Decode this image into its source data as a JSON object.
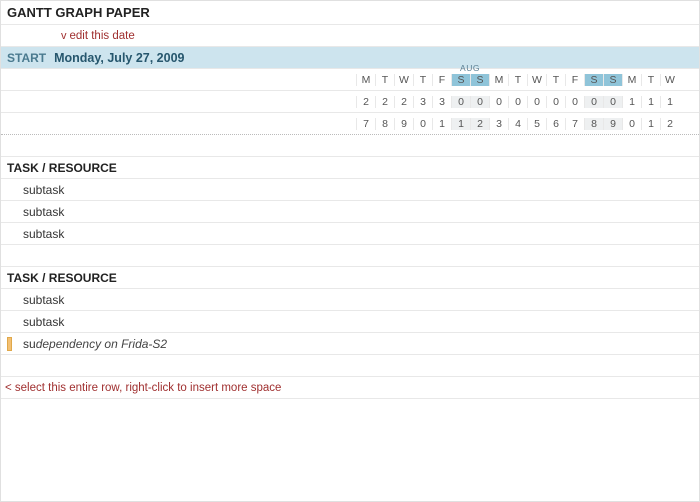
{
  "title": "GANTT GRAPH PAPER",
  "edit_hint": "edit this date",
  "edit_chevron": "v",
  "start_label": "START",
  "start_date": "Monday, July 27, 2009",
  "month_label": "AUG",
  "day_letters": [
    "M",
    "T",
    "W",
    "T",
    "F",
    "S",
    "S",
    "M",
    "T",
    "W",
    "T",
    "F",
    "S",
    "S",
    "M",
    "T",
    "W"
  ],
  "day_digits_top": [
    "2",
    "2",
    "2",
    "3",
    "3",
    "0",
    "0",
    "0",
    "0",
    "0",
    "0",
    "0",
    "0",
    "0",
    "1",
    "1",
    "1"
  ],
  "day_digits_bot": [
    "7",
    "8",
    "9",
    "0",
    "1",
    "1",
    "2",
    "3",
    "4",
    "5",
    "6",
    "7",
    "8",
    "9",
    "0",
    "1",
    "2"
  ],
  "weekend_cols": [
    5,
    6,
    12,
    13
  ],
  "task_header": "TASK / RESOURCE",
  "rows_group1": [
    {
      "label": "subtask"
    },
    {
      "label": "subtask"
    },
    {
      "label": "subtask"
    }
  ],
  "rows_group2": [
    {
      "label": "subtask"
    },
    {
      "label": "subtask"
    },
    {
      "prefix": "su ",
      "dep": "dependency on Frida-S2",
      "orange": true
    }
  ],
  "insert_hint": "< select this entire row, right-click to insert more space"
}
